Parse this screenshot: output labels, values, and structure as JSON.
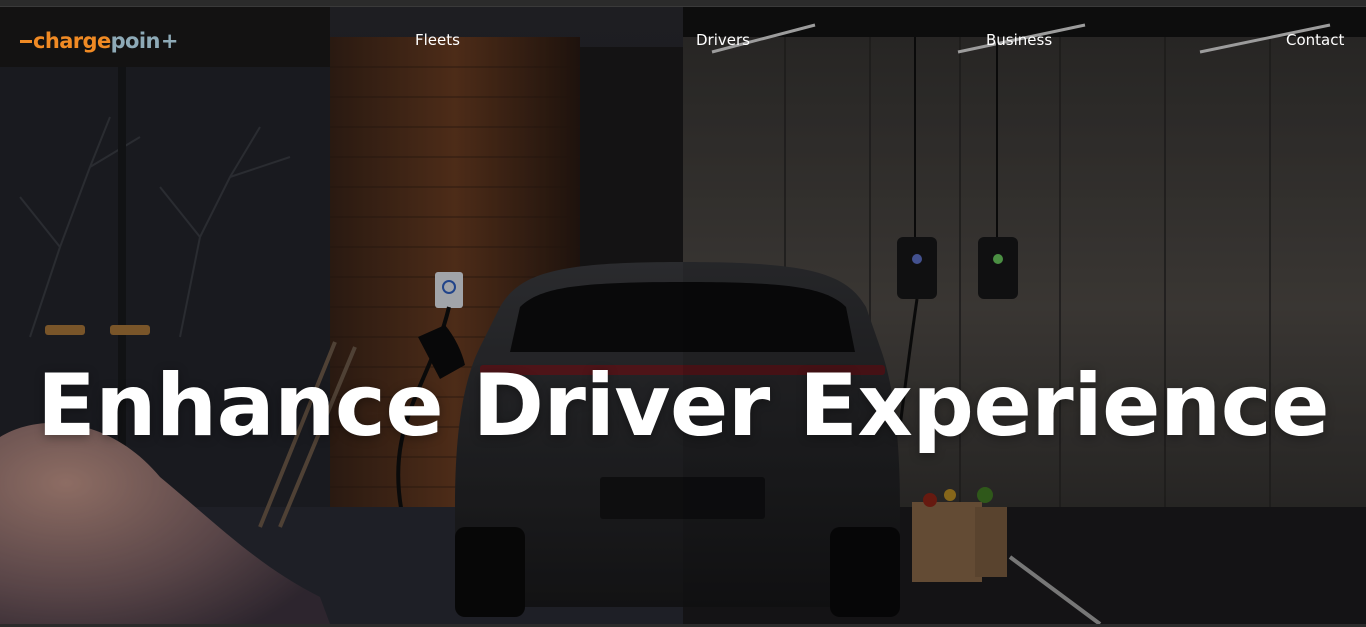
{
  "brand": {
    "logo_part1": "charge",
    "logo_part2": "poin",
    "logo_plus": "+",
    "colors": {
      "orange": "#f08a24",
      "steel": "#8eaab7"
    }
  },
  "nav": {
    "items": [
      {
        "label": "Fleets"
      },
      {
        "label": "Drivers"
      },
      {
        "label": "Business"
      },
      {
        "label": "Contact"
      }
    ]
  },
  "hero": {
    "headline": "Enhance Driver Experience",
    "left_scene": "home-garage-snow",
    "right_scene": "underground-parking"
  }
}
